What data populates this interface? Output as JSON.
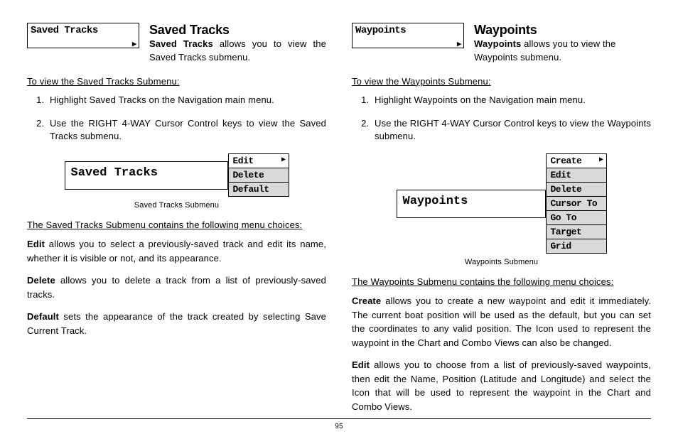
{
  "page_number": "95",
  "left": {
    "devbox": "Saved Tracks",
    "title": "Saved Tracks",
    "intro_bold": "Saved Tracks",
    "intro_rest": " allows you to view the Saved Tracks submenu.",
    "subhead": "To view the Saved Tracks Submenu:",
    "step1": "Highlight Saved Tracks on the Navigation main menu.",
    "step2": "Use the RIGHT 4-WAY Cursor Control keys to view the Saved Tracks submenu.",
    "fig_label": "Saved Tracks",
    "menu": {
      "m1": "Edit",
      "m2": "Delete",
      "m3": "Default"
    },
    "caption": "Saved Tracks Submenu",
    "choices_head": "The Saved Tracks Submenu contains the following menu choices:",
    "p1_bold": "Edit",
    "p1_rest": " allows you to select a previously-saved track and edit its name, whether it is visible or not, and its appearance.",
    "p2_bold": "Delete",
    "p2_rest": " allows you to delete a track from a list of previously-saved tracks.",
    "p3_bold": "Default",
    "p3_rest": " sets the appearance of the track created by selecting Save Current Track."
  },
  "right": {
    "devbox": "Waypoints",
    "title": "Waypoints",
    "intro_bold": "Waypoints",
    "intro_rest": " allows you to view the Waypoints submenu.",
    "subhead": "To view the Waypoints Submenu:",
    "step1": "Highlight Waypoints on the Navigation main menu.",
    "step2": "Use the RIGHT 4-WAY Cursor Control keys to view the Waypoints submenu.",
    "fig_label": "Waypoints",
    "menu": {
      "m1": "Create",
      "m2": "Edit",
      "m3": "Delete",
      "m4": "Cursor To",
      "m5": "Go To",
      "m6": "Target",
      "m7": "Grid"
    },
    "caption": "Waypoints Submenu",
    "choices_head": "The Waypoints Submenu contains the following menu choices:",
    "p1_bold": "Create",
    "p1_rest": " allows you to create a new waypoint and edit it immediately. The current boat position will be used as the default, but you can set the coordinates to any valid position. The Icon used to represent the waypoint in the Chart and Combo Views can also be changed.",
    "p2_bold": "Edit",
    "p2_rest": " allows you to choose from a list of previously-saved waypoints, then edit the Name, Position (Latitude and Longitude) and select the Icon that will be used to represent the waypoint in the Chart and Combo Views."
  }
}
